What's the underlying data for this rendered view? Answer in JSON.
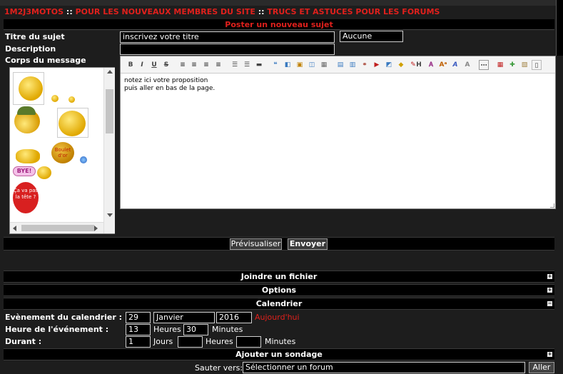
{
  "breadcrumb": {
    "home": "1M2J3MOTOS",
    "sep1": "::",
    "section": "POUR LES NOUVEAUX MEMBRES DU SITE",
    "sep2": "::",
    "forum": "TRUCS ET ASTUCES POUR LES FORUMS"
  },
  "form_header": "Poster un nouveau sujet",
  "subject": {
    "label": "Titre du sujet",
    "value": "inscrivez votre titre",
    "icon_select": "Aucune"
  },
  "description": {
    "label": "Description",
    "value": ""
  },
  "body": {
    "label": "Corps du message",
    "lines": [
      "notez ici votre proposition",
      "puis aller en bas de la page."
    ]
  },
  "smilies": [
    "Boulet d'or",
    "BYE!",
    "Ça va pas la tête ?"
  ],
  "toolbar": {
    "bold": "B",
    "italic": "I",
    "underline": "U",
    "strike": "S",
    "h_letter": "H",
    "a_letter": "A"
  },
  "buttons": {
    "preview": "Prévisualiser",
    "send": "Envoyer",
    "go": "Aller"
  },
  "sections": {
    "attach": "Joindre un fichier",
    "options": "Options",
    "calendar": "Calendrier",
    "poll": "Ajouter un sondage"
  },
  "calendar": {
    "event_label": "Evènement du calendrier :",
    "day": "29",
    "month": "Janvier",
    "year": "2016",
    "today": "Aujourd'hui",
    "time_label": "Heure de l'événement :",
    "hours": "13",
    "hours_unit": "Heures",
    "minutes": "30",
    "minutes_unit": "Minutes",
    "duration_label": "Durant :",
    "dur_days": "1",
    "days_unit": "Jours",
    "dur_hours": "",
    "dur_hours_unit": "Heures",
    "dur_minutes": "",
    "dur_minutes_unit": "Minutes"
  },
  "jump": {
    "label": "Sauter vers:",
    "value": "Sélectionner un forum"
  },
  "colors": {
    "accent": "#e0201c",
    "background": "#1d1d1d",
    "bar": "#000000"
  }
}
